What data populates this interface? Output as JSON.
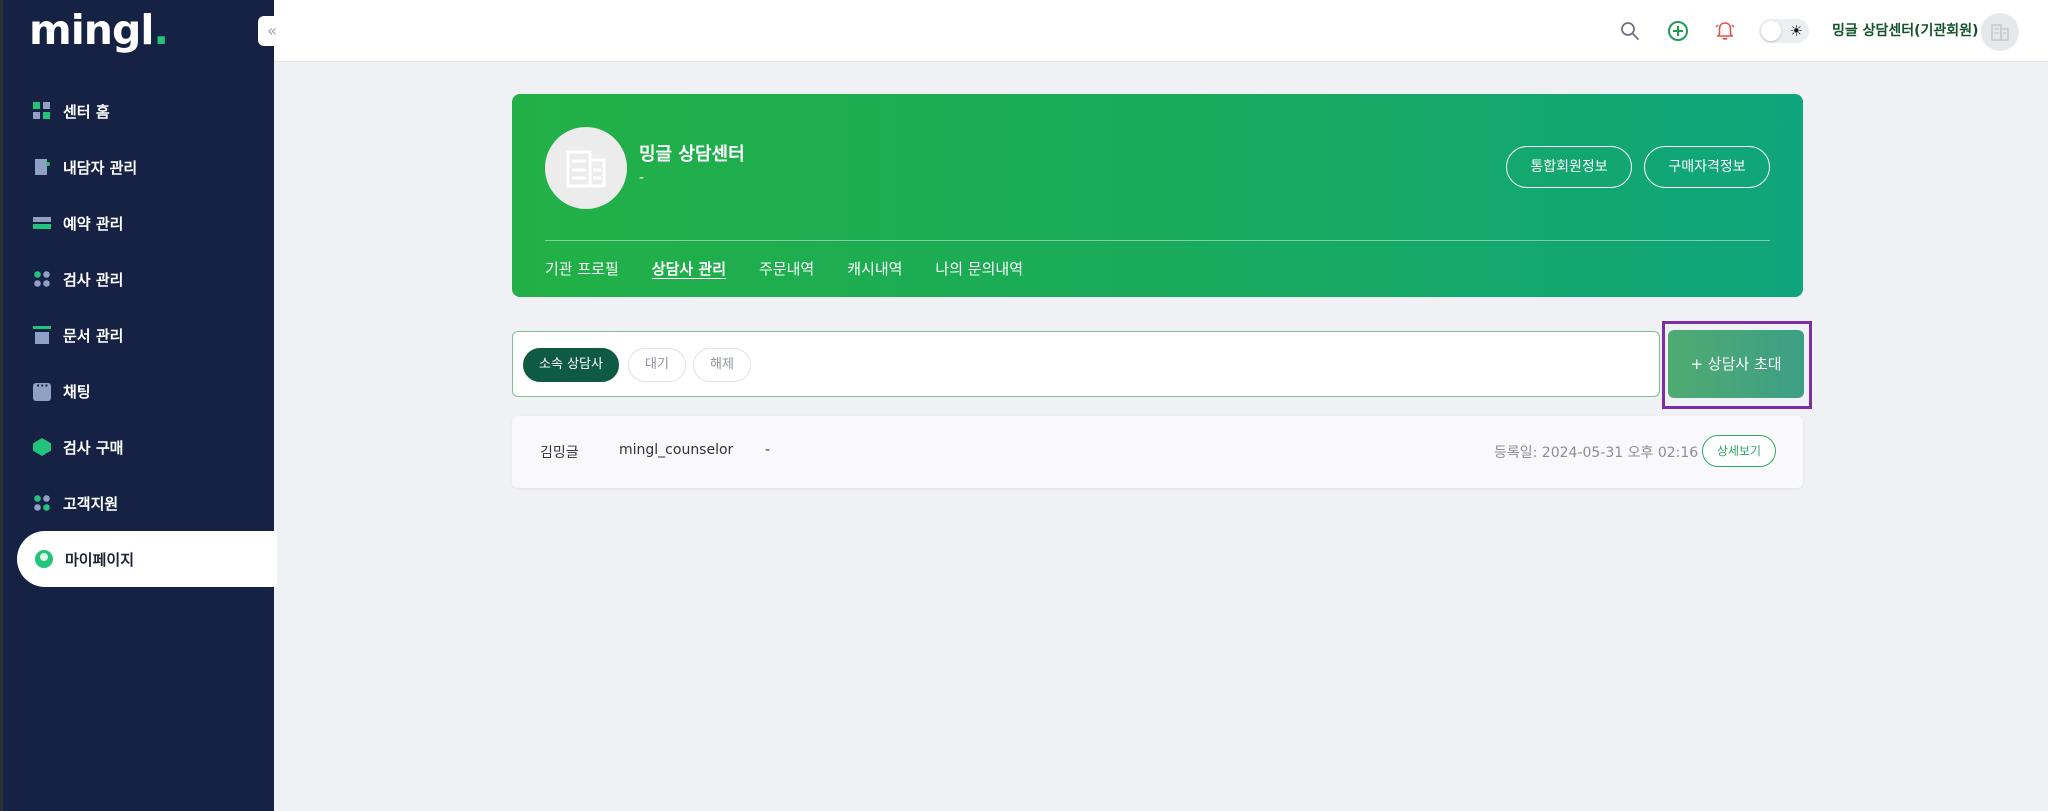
{
  "app": {
    "logo_text": "mingl",
    "logo_dot": "."
  },
  "sidebar": {
    "collapse_label": "«",
    "items": [
      {
        "label": "센터 홈",
        "icon": "grid-icon"
      },
      {
        "label": "내담자 관리",
        "icon": "document-icon"
      },
      {
        "label": "예약 관리",
        "icon": "toggle-icon"
      },
      {
        "label": "검사 관리",
        "icon": "dots-icon"
      },
      {
        "label": "문서 관리",
        "icon": "calendar-icon"
      },
      {
        "label": "채팅",
        "icon": "chat-icon"
      },
      {
        "label": "검사 구매",
        "icon": "layers-icon"
      },
      {
        "label": "고객지원",
        "icon": "support-icon"
      },
      {
        "label": "마이페이지",
        "icon": "user-icon",
        "active": true
      }
    ]
  },
  "topbar": {
    "user_name": "밍글 상담센터(기관회원)",
    "icons": [
      "search-icon",
      "add-circle-icon",
      "bell-icon",
      "theme-toggle",
      "avatar"
    ]
  },
  "banner": {
    "org_name": "밍글 상담센터",
    "org_sub": "-",
    "btn_member_info": "통합회원정보",
    "btn_purchase_info": "구매자격정보",
    "tabs": [
      {
        "label": "기관 프로필"
      },
      {
        "label": "상담사 관리",
        "active": true
      },
      {
        "label": "주문내역"
      },
      {
        "label": "캐시내역"
      },
      {
        "label": "나의 문의내역"
      }
    ]
  },
  "filter": {
    "chips": [
      {
        "label": "소속 상담사",
        "active": true
      },
      {
        "label": "대기"
      },
      {
        "label": "해제"
      }
    ],
    "invite_label": "+ 상담사 초대"
  },
  "counselors": [
    {
      "name": "김밍글",
      "username": "mingl_counselor",
      "extra": "-",
      "registered": "등록일: 2024-05-31 오후 02:16",
      "detail_label": "상세보기"
    }
  ],
  "colors": {
    "sidebar_bg": "#162244",
    "brand_green": "#21c47a",
    "banner_start": "#22b046",
    "banner_end": "#0fa57c",
    "chip_active": "#0f5a43",
    "highlight_outline": "#7b2fa6"
  }
}
